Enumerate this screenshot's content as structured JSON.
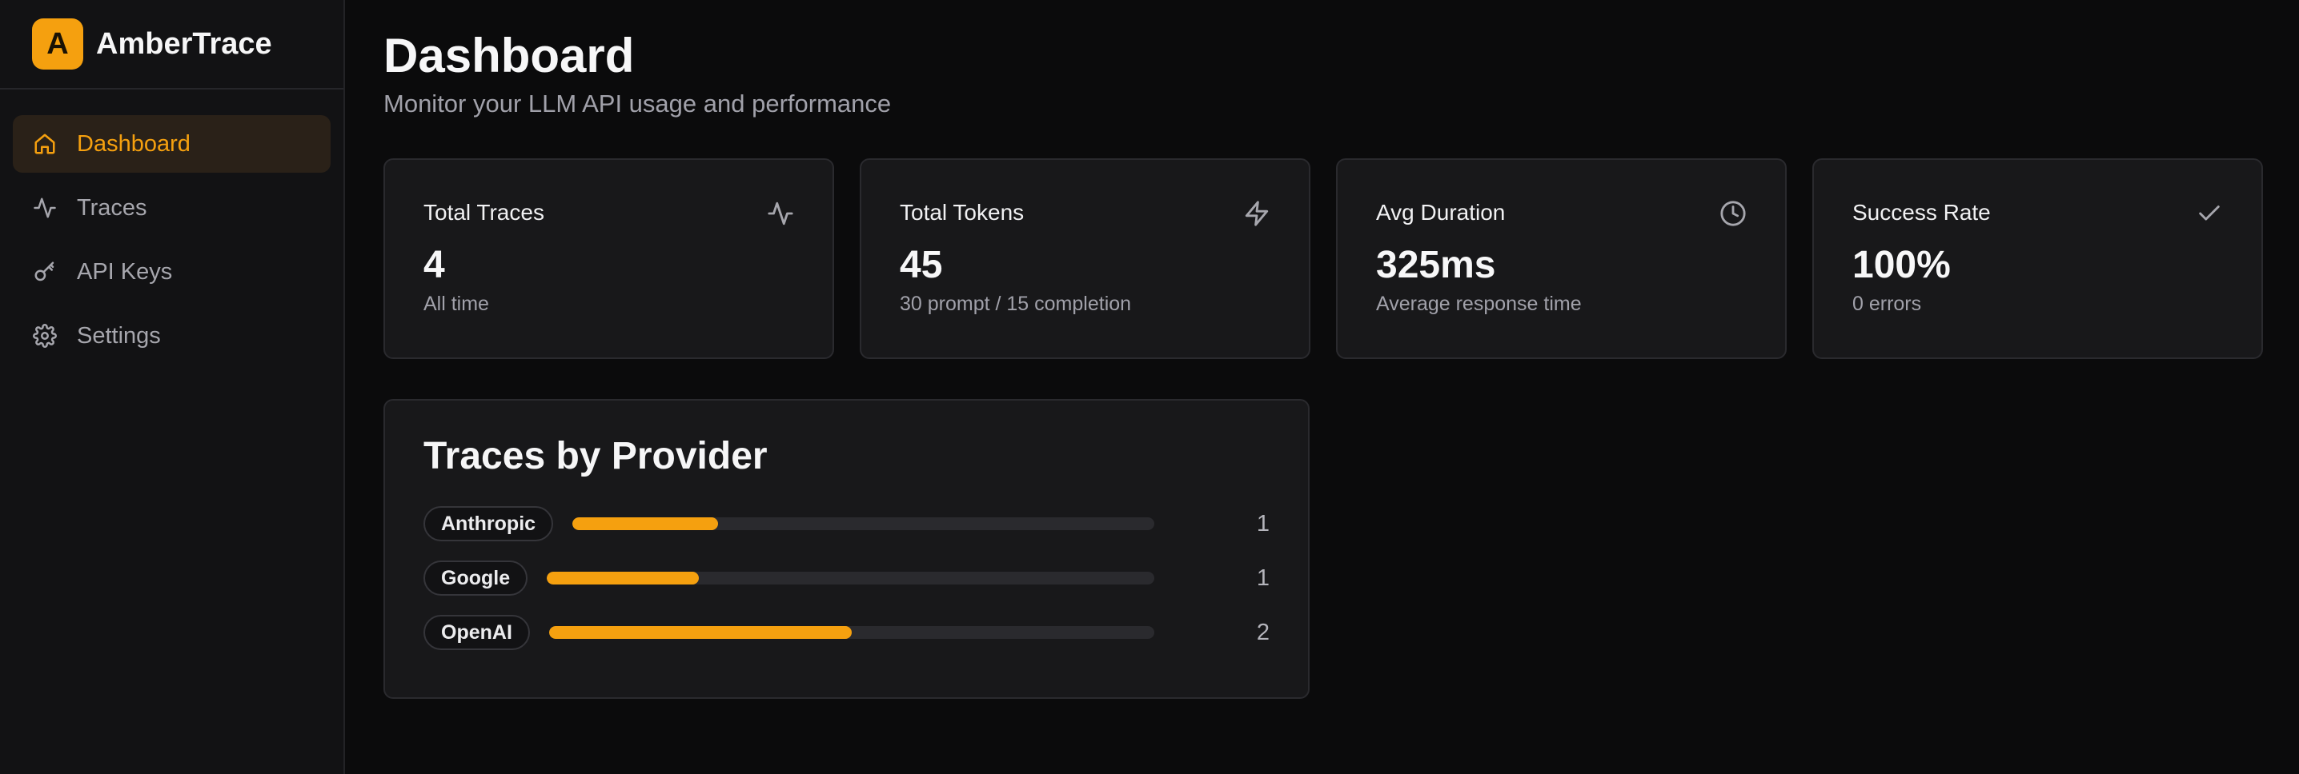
{
  "app": {
    "brand_initial": "A",
    "brand_name": "AmberTrace",
    "accent_color": "#f5a00f"
  },
  "sidebar": {
    "items": [
      {
        "label": "Dashboard",
        "icon": "home-icon",
        "active": true
      },
      {
        "label": "Traces",
        "icon": "activity-icon",
        "active": false
      },
      {
        "label": "API Keys",
        "icon": "key-icon",
        "active": false
      },
      {
        "label": "Settings",
        "icon": "gear-icon",
        "active": false
      }
    ]
  },
  "header": {
    "title": "Dashboard",
    "subtitle": "Monitor your LLM API usage and performance"
  },
  "stats": [
    {
      "label": "Total Traces",
      "value": "4",
      "sub": "All time",
      "icon": "activity-icon"
    },
    {
      "label": "Total Tokens",
      "value": "45",
      "sub": "30 prompt / 15 completion",
      "icon": "lightning-icon"
    },
    {
      "label": "Avg Duration",
      "value": "325ms",
      "sub": "Average response time",
      "icon": "clock-icon"
    },
    {
      "label": "Success Rate",
      "value": "100%",
      "sub": "0 errors",
      "icon": "check-icon"
    }
  ],
  "providers": {
    "title": "Traces by Provider",
    "items": [
      {
        "name": "Anthropic",
        "count": "1",
        "fraction": 0.25
      },
      {
        "name": "Google",
        "count": "1",
        "fraction": 0.25
      },
      {
        "name": "OpenAI",
        "count": "2",
        "fraction": 0.5
      }
    ]
  }
}
